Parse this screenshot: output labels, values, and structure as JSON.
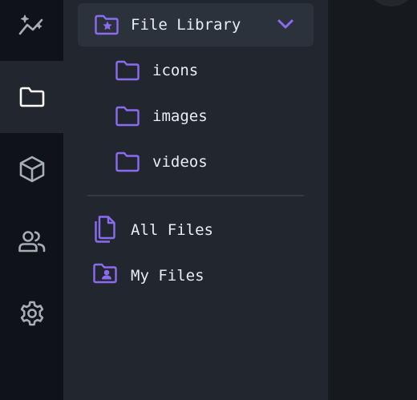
{
  "colors": {
    "accent": "#8b6cf0",
    "rail_icon": "#a7adb6",
    "rail_icon_active": "#ffffff",
    "text": "#e9edf2"
  },
  "rail": {
    "items": [
      {
        "icon": "analytics-icon",
        "active": false
      },
      {
        "icon": "folder-icon",
        "active": true
      },
      {
        "icon": "cube-icon",
        "active": false
      },
      {
        "icon": "users-icon",
        "active": false
      },
      {
        "icon": "settings-gear-icon",
        "active": false
      }
    ]
  },
  "library": {
    "title": "File Library",
    "expanded": true,
    "folders": [
      {
        "label": "icons"
      },
      {
        "label": "images"
      },
      {
        "label": "videos"
      }
    ]
  },
  "sections": [
    {
      "label": "All Files",
      "icon": "files-copy-icon"
    },
    {
      "label": "My Files",
      "icon": "user-folder-icon"
    }
  ]
}
